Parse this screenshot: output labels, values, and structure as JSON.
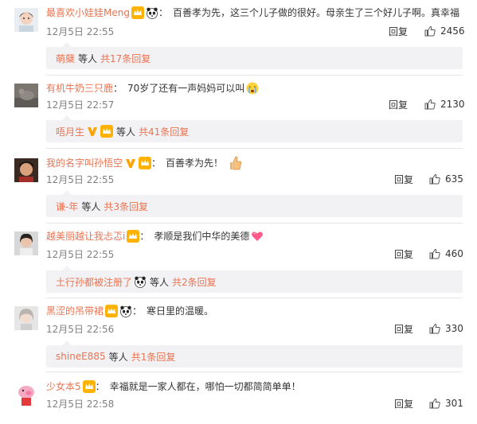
{
  "comments": [
    {
      "username": "最喜欢小娃娃Meng",
      "badges": [
        "crown-badge",
        "panda-badge"
      ],
      "text": "百善孝为先，这三个儿子做的很好。母亲生了三个好儿子啊。真幸福",
      "time": "12月5日 22:55",
      "reply_label": "回复",
      "likes": "2456",
      "sub": {
        "name": "萌蘖",
        "connector": "等人",
        "more": "共17条回复"
      }
    },
    {
      "username": "有机牛奶三只鹿",
      "badges": [],
      "text": "70岁了还有一声妈妈可以叫",
      "emoji": "crying-face-emoji",
      "time": "12月5日 22:57",
      "reply_label": "回复",
      "likes": "2130",
      "sub": {
        "name": "唔月生",
        "connector": "等人",
        "more": "共41条回复"
      }
    },
    {
      "username": "我的名字叫孙悟空",
      "badges": [
        "v-badge",
        "crown-badge"
      ],
      "text": "百善孝为先！",
      "emoji": "thumbs-up-emoji",
      "time": "12月5日 22:55",
      "reply_label": "回复",
      "likes": "635",
      "sub": {
        "name": "谦-年",
        "connector": "等人",
        "more": "共3条回复"
      }
    },
    {
      "username": "越美丽越让我忐忑i",
      "badges": [
        "crown-badge"
      ],
      "text": "孝顺是我们中华的美德",
      "emoji": "heart-emoji",
      "time": "12月5日 22:55",
      "reply_label": "回复",
      "likes": "460",
      "sub": {
        "name": "土行孙都被注册了",
        "connector": "等人",
        "more": "共2条回复"
      }
    },
    {
      "username": "黑涩的吊带裙",
      "badges": [
        "crown-badge",
        "panda-badge"
      ],
      "text": "寒日里的温暖。",
      "time": "12月5日 22:56",
      "reply_label": "回复",
      "likes": "330",
      "sub": {
        "name": "shineE885",
        "connector": "等人",
        "more": "共1条回复"
      }
    },
    {
      "username": "少女本5",
      "badges": [
        "crown-badge"
      ],
      "text": "幸福就是一家人都在，哪怕一切都简简单单！",
      "time": "12月5日 22:58",
      "reply_label": "回复",
      "likes": "301"
    }
  ],
  "colors": {
    "username": "#eb7350",
    "text": "#333333",
    "time": "#808080",
    "subbox_bg": "#f2f2f5"
  }
}
